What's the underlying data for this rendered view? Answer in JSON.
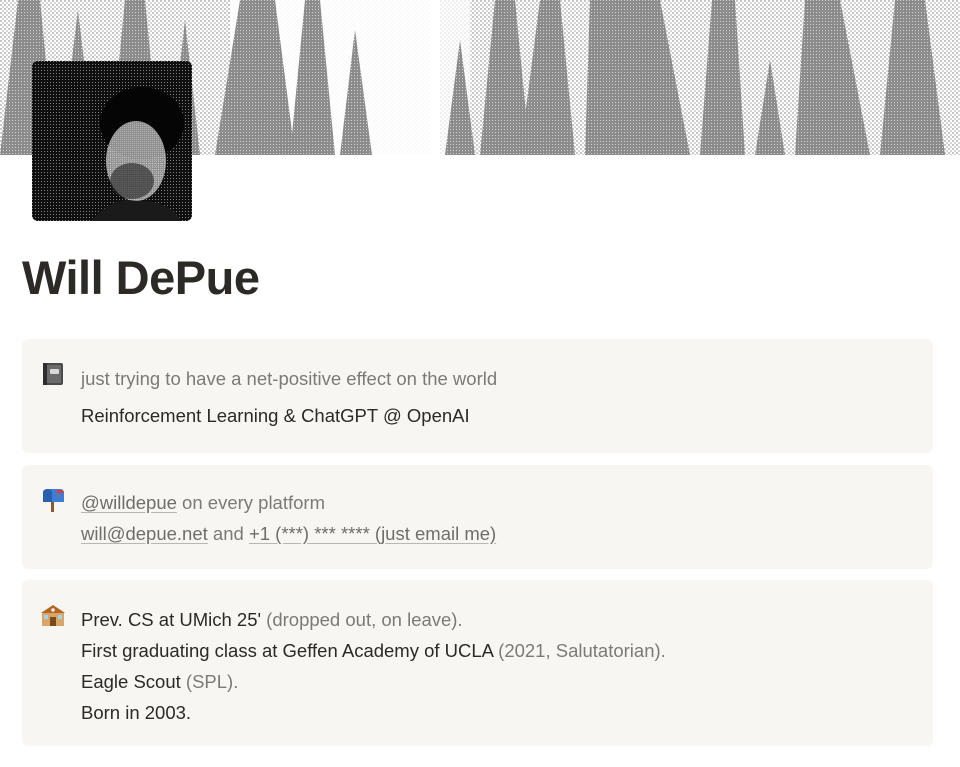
{
  "profile": {
    "name": "Will DePue"
  },
  "callouts": [
    {
      "icon": "notebook-icon",
      "lines": [
        {
          "text": "just trying to have a net-positive effect on the world"
        },
        {
          "text": "Reinforcement Learning & ChatGPT @ OpenAI"
        }
      ]
    },
    {
      "icon": "mailbox-icon",
      "handle_link": "@willdepue",
      "handle_suffix": " on every platform",
      "email_link": "will@depue.net",
      "and_text": " and ",
      "phone_link": "+1 (***) *** **** (just email me)"
    },
    {
      "icon": "school-icon",
      "edu_main": "Prev. CS at UMich 25'",
      "edu_note": " (dropped out, on leave).",
      "hs_main": "First graduating class at Geffen Academy of UCLA",
      "hs_note": " (2021, Salutatorian).",
      "scout_main": "Eagle Scout",
      "scout_note": " (SPL).",
      "born": "Born in 2003."
    }
  ],
  "colors": {
    "callout_bg": "#f7f6f3",
    "text_dark": "#2b2a27",
    "text_muted": "#7b7a76",
    "cover_gray": "#8a8a8a"
  }
}
